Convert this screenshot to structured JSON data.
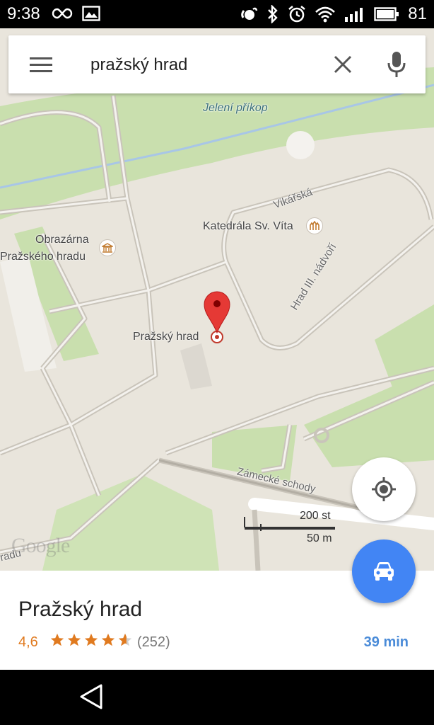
{
  "status_bar": {
    "time": "9:38",
    "battery_percent": "81",
    "icons_left": [
      "infinity-icon",
      "image-icon"
    ],
    "icons_right": [
      "nfc-icon",
      "bluetooth-icon",
      "alarm-icon",
      "wifi-icon",
      "signal-icon",
      "battery-icon"
    ]
  },
  "search": {
    "query": "pražský hrad",
    "menu_icon": "hamburger-icon",
    "clear_icon": "close-icon",
    "voice_icon": "mic-icon"
  },
  "map": {
    "labels": {
      "jeleni_prikop": "Jelení příkop",
      "vikarska": "Vikářská",
      "katedrala": "Katedrála Sv. Víta",
      "obrazarna_1": "Obrazárna",
      "obrazarna_2": "Pražského hradu",
      "prazsky_hrad": "Pražský hrad",
      "hrad_nadvori": "Hrad III. nádvoří",
      "zamecke_schody": "Zámecké schody",
      "edge_road": "radu"
    },
    "logo": "Google",
    "scale": {
      "top": "200 st",
      "bottom": "50 m"
    },
    "colors": {
      "background": "#e9e5dc",
      "park": "#c9dfae",
      "water": "#a8c6e6",
      "pin": "#e53935"
    }
  },
  "place": {
    "name": "Pražský hrad",
    "rating": "4,6",
    "rating_value": 4.6,
    "reviews": "(252)",
    "travel_time": "39 min"
  },
  "buttons": {
    "locate_icon": "my-location-icon",
    "directions_icon": "car-icon",
    "accent": "#4285f4"
  },
  "nav": {
    "back_icon": "back-triangle-icon"
  }
}
